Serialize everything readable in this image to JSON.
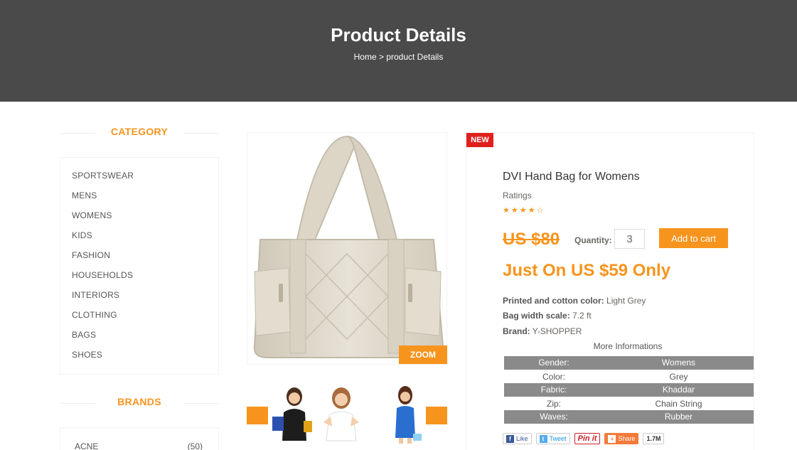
{
  "header": {
    "title": "Product Details",
    "breadcrumb": "Home > product Details"
  },
  "sidebar": {
    "category_title": "CATEGORY",
    "categories": [
      "SPORTSWEAR",
      "MENS",
      "WOMENS",
      "KIDS",
      "FASHION",
      "HOUSEHOLDS",
      "INTERIORS",
      "CLOTHING",
      "BAGS",
      "SHOES"
    ],
    "brands_title": "BRANDS",
    "brands": [
      {
        "name": "ACNE",
        "count": "(50)"
      }
    ]
  },
  "gallery": {
    "zoom_label": "ZOOM",
    "main_image_icon": "tote-bag-image",
    "thumbnail_icons": [
      "woman-shopping-image",
      "woman-smiling-image",
      "woman-blue-dress-image"
    ]
  },
  "product": {
    "badge": "NEW",
    "name": "DVI Hand Bag for Womens",
    "ratings_label": "Ratings",
    "stars": "★★★★☆",
    "rating_value": 4.5,
    "old_price": "US $80",
    "quantity_label": "Quantity:",
    "quantity_value": "3",
    "add_to_cart": "Add to cart",
    "offer": "Just On US $59 Only",
    "specs": [
      {
        "label": "Printed and cotton color:",
        "value": "Light Grey"
      },
      {
        "label": "Bag width scale:",
        "value": "7.2 ft"
      },
      {
        "label": "Brand:",
        "value": "Y-SHOPPER"
      }
    ],
    "more_info_title": "More Informations",
    "info_table": [
      {
        "key": "Gender:",
        "value": "Womens"
      },
      {
        "key": "Color:",
        "value": "Grey"
      },
      {
        "key": "Fabric:",
        "value": "Khaddar"
      },
      {
        "key": "Zip:",
        "value": "Chain String"
      },
      {
        "key": "Waves:",
        "value": "Rubber"
      }
    ]
  },
  "share": {
    "like": "Like",
    "tweet": "Tweet",
    "pin": "Pin it",
    "share": "Share",
    "count": "1.7M"
  },
  "colors": {
    "accent": "#f7941d",
    "banner": "#4a4a4a",
    "badge": "#e0201d"
  }
}
